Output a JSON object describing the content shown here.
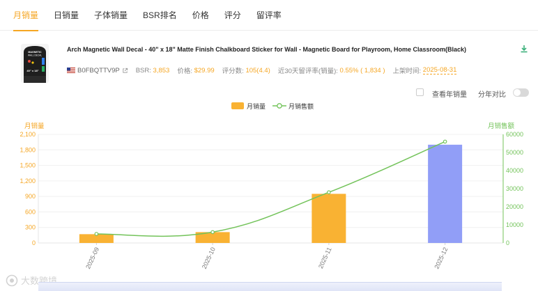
{
  "tabs": [
    {
      "label": "月销量",
      "active": true
    },
    {
      "label": "日销量",
      "active": false
    },
    {
      "label": "子体销量",
      "active": false
    },
    {
      "label": "BSR排名",
      "active": false
    },
    {
      "label": "价格",
      "active": false
    },
    {
      "label": "评分",
      "active": false
    },
    {
      "label": "留评率",
      "active": false
    }
  ],
  "product": {
    "title": "Arch Magnetic Wall Decal - 40\" x 18\" Matte Finish Chalkboard Sticker for Wall - Magnetic Board for Playroom, Home Classroom(Black)",
    "image_text_top": "MAGNETIC\nWALL DECAL",
    "image_text_size": "40\" x 18\"",
    "asin": "B0FBQTTV9P",
    "bsr_label": "BSR:",
    "bsr_value": "3,853",
    "price_label": "价格:",
    "price_value": "$29.99",
    "reviews_label": "评分数:",
    "reviews_value": "105(4.4)",
    "review_rate_label": "近30天留评率(销量):",
    "review_rate_value": "0.55% ( 1,834 )",
    "listed_label": "上架时间:",
    "listed_value": "2025-08-31"
  },
  "controls": {
    "view_year_sales": "查看年销量",
    "yoy_compare": "分年对比"
  },
  "colors": {
    "accent": "#f5a623",
    "bar_default": "#f9b233",
    "bar_highlight": "#919ef7",
    "line": "#73c35a"
  },
  "chart_data": {
    "type": "bar",
    "categories": [
      "2025-09",
      "2025-10",
      "2025-11",
      "2025-12"
    ],
    "series": [
      {
        "name": "月销量",
        "type": "bar",
        "axis": "left",
        "values": [
          170,
          210,
          950,
          1900
        ],
        "highlight_index": 3
      },
      {
        "name": "月销售额",
        "type": "line",
        "axis": "right",
        "values": [
          5000,
          6000,
          28000,
          56000
        ]
      }
    ],
    "ylabel_left": "月销量",
    "ylabel_right": "月销售额",
    "ylim_left": [
      0,
      2100
    ],
    "yticks_left": [
      "0",
      "300",
      "600",
      "900",
      "1,200",
      "1,500",
      "1,800",
      "2,100"
    ],
    "ylim_right": [
      0,
      60000
    ],
    "yticks_right": [
      "0",
      "10000",
      "20000",
      "30000",
      "40000",
      "50000",
      "60000"
    ],
    "grid": true,
    "legend": "top-center"
  },
  "watermark_text": "大数跨境"
}
